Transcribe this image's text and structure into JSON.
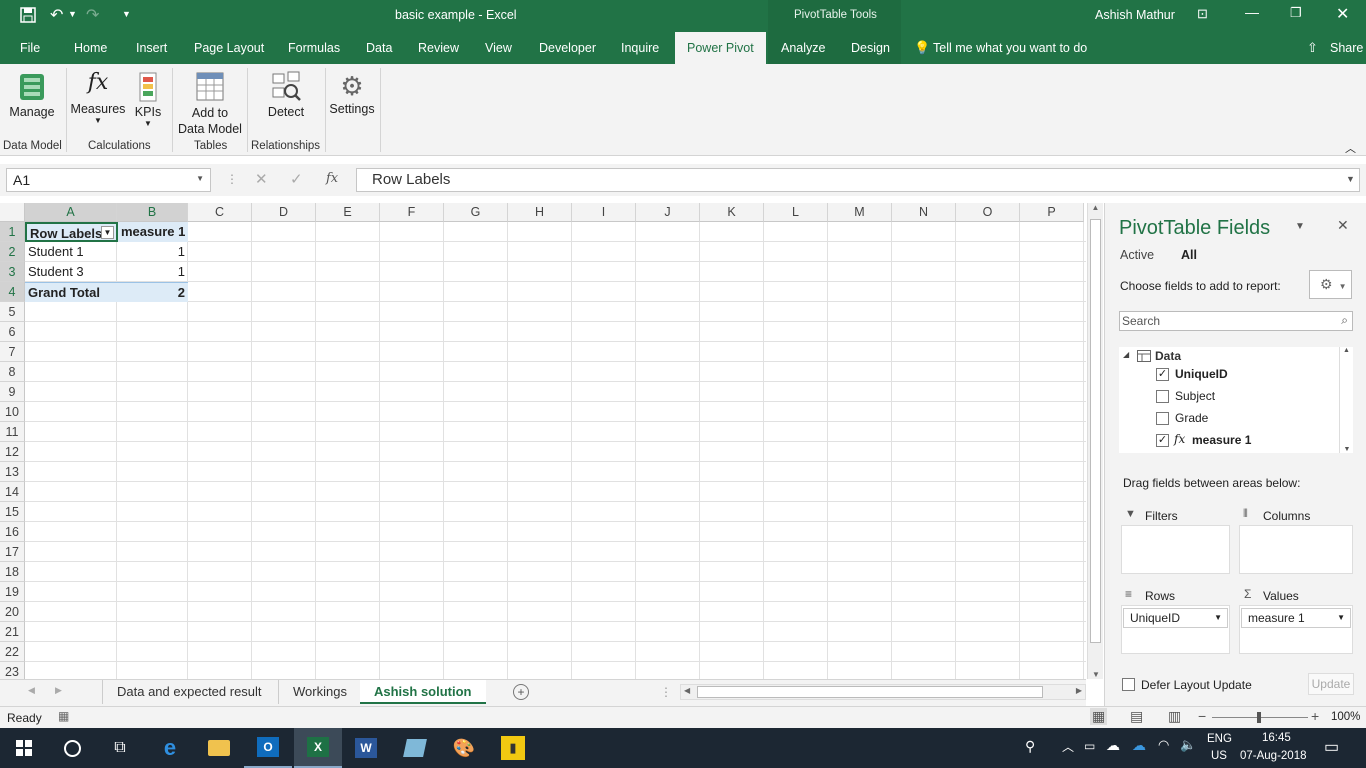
{
  "window": {
    "title": "basic example  -  Excel",
    "context_tools": "PivotTable Tools",
    "user": "Ashish Mathur"
  },
  "tabs": [
    {
      "label": "File"
    },
    {
      "label": "Home"
    },
    {
      "label": "Insert"
    },
    {
      "label": "Page Layout"
    },
    {
      "label": "Formulas"
    },
    {
      "label": "Data"
    },
    {
      "label": "Review"
    },
    {
      "label": "View"
    },
    {
      "label": "Developer"
    },
    {
      "label": "Inquire"
    },
    {
      "label": "Power Pivot"
    },
    {
      "label": "Analyze"
    },
    {
      "label": "Design"
    }
  ],
  "tell_me": "Tell me what you want to do",
  "share": "Share",
  "ribbon": {
    "manage": "Manage",
    "measures": "Measures",
    "kpis": "KPIs",
    "add_to": "Add to",
    "data_model": "Data Model",
    "detect": "Detect",
    "settings": "Settings",
    "groups": {
      "data_model": "Data Model",
      "calculations": "Calculations",
      "tables": "Tables",
      "relationships": "Relationships"
    }
  },
  "formula_bar": {
    "name_box": "A1",
    "fx": "fx",
    "formula": "Row Labels"
  },
  "columns": [
    "A",
    "B",
    "C",
    "D",
    "E",
    "F",
    "G",
    "H",
    "I",
    "J",
    "K",
    "L",
    "M",
    "N",
    "O",
    "P"
  ],
  "rows": [
    "1",
    "2",
    "3",
    "4",
    "5",
    "6",
    "7",
    "8",
    "9",
    "10",
    "11",
    "12",
    "13",
    "14",
    "15",
    "16",
    "17",
    "18",
    "19",
    "20",
    "21",
    "22",
    "23"
  ],
  "pivot": {
    "header_a": "Row Labels",
    "header_b": "measure 1",
    "r2a": "Student 1",
    "r2b": "1",
    "r3a": "Student 3",
    "r3b": "1",
    "r4a": "Grand Total",
    "r4b": "2"
  },
  "sheets": [
    {
      "label": "Data and expected result"
    },
    {
      "label": "Workings"
    },
    {
      "label": "Ashish solution"
    }
  ],
  "status": {
    "ready": "Ready",
    "zoom": "100%"
  },
  "pane": {
    "title": "PivotTable Fields",
    "tab_active": "Active",
    "tab_all": "All",
    "choose": "Choose fields to add to report:",
    "search_placeholder": "Search",
    "table_name": "Data",
    "fields": [
      {
        "label": "UniqueID",
        "checked": true
      },
      {
        "label": "Subject",
        "checked": false
      },
      {
        "label": "Grade",
        "checked": false
      },
      {
        "label": "measure 1",
        "checked": true
      }
    ],
    "drag": "Drag fields between areas below:",
    "filters": "Filters",
    "columns": "Columns",
    "rows": "Rows",
    "values": "Values",
    "rows_field": "UniqueID",
    "values_field": "measure 1",
    "defer": "Defer Layout Update",
    "update": "Update"
  },
  "taskbar": {
    "lang1": "ENG",
    "lang2": "US",
    "time": "16:45",
    "date": "07-Aug-2018"
  }
}
